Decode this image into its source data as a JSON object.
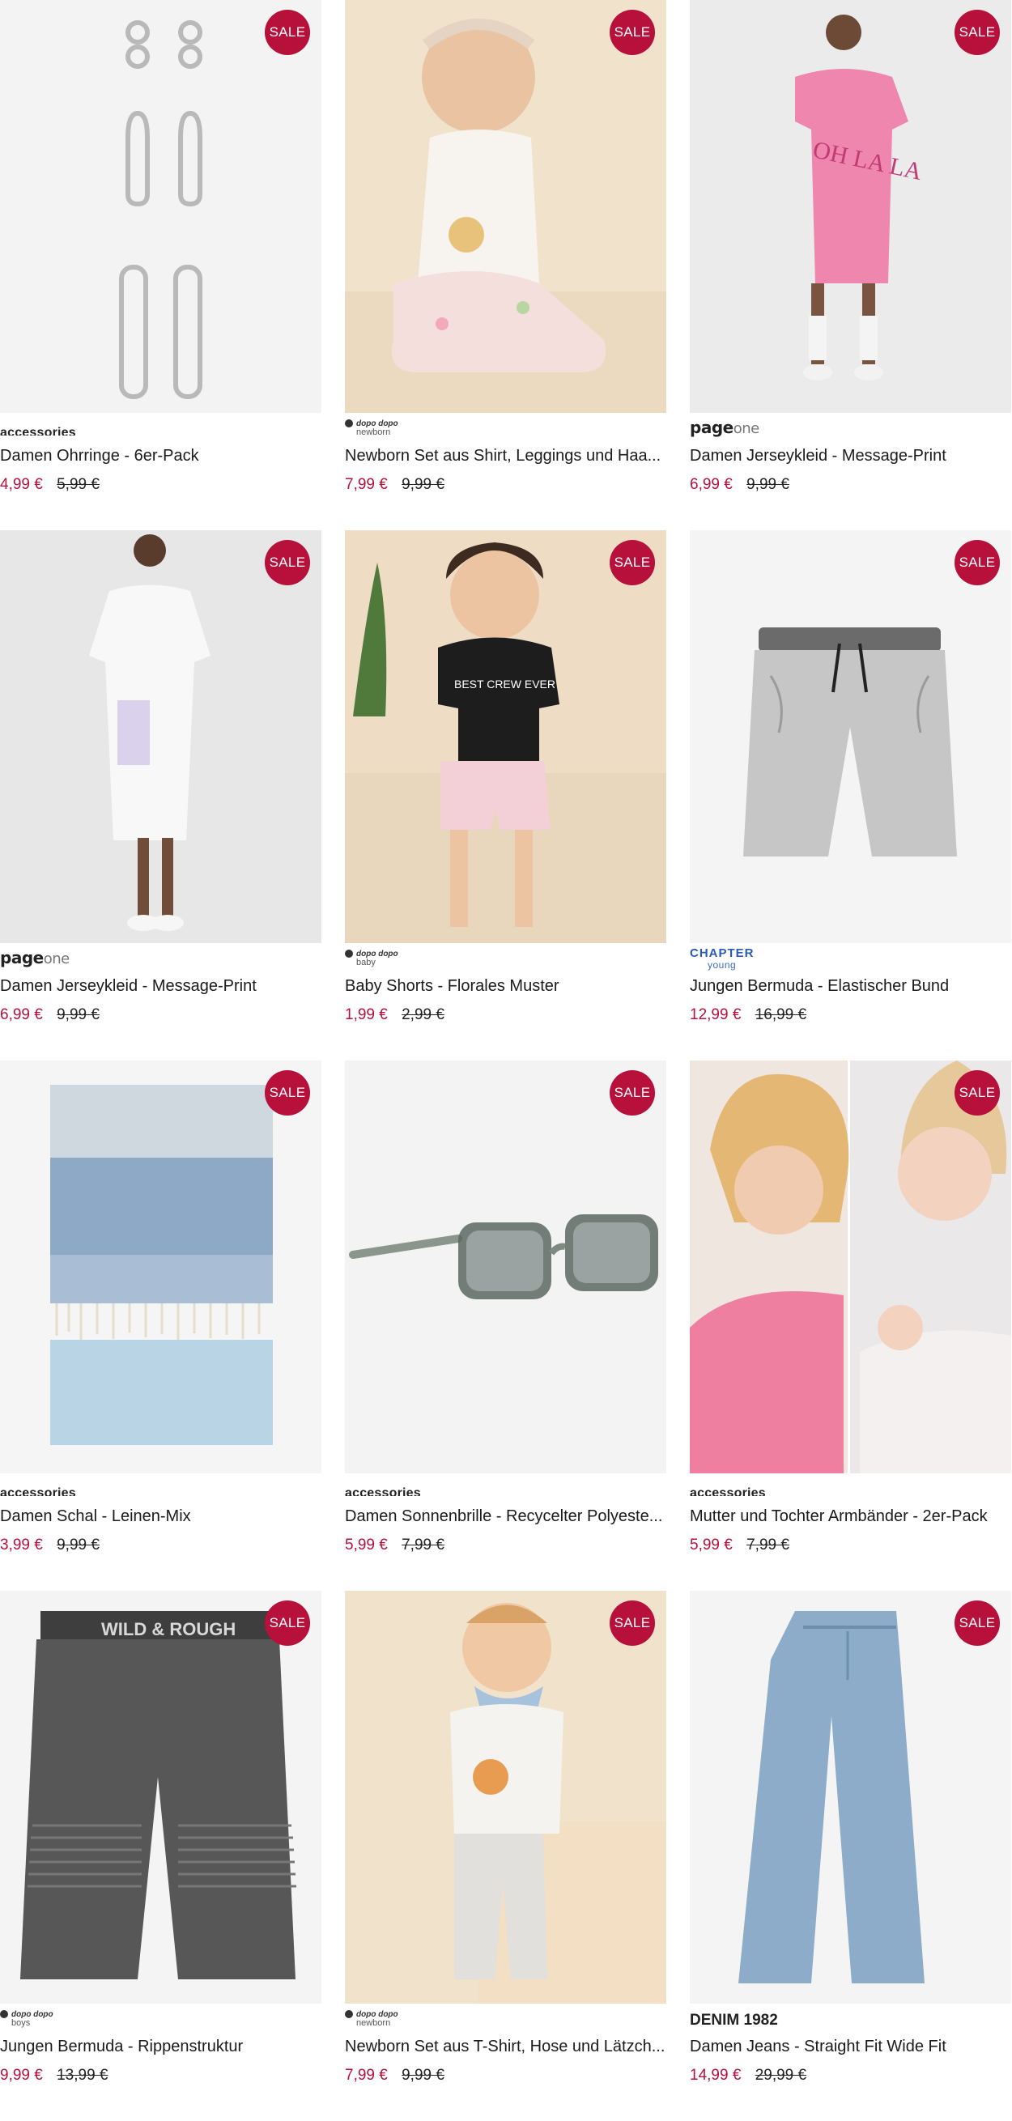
{
  "sale_label": "SALE",
  "products": [
    {
      "brand": "accessories",
      "title": "Damen Ohrringe - 6er-Pack",
      "price": "4,99 €",
      "old_price": "5,99 €"
    },
    {
      "brand": "dopo dopo",
      "brand_sub": "newborn",
      "title": "Newborn Set aus Shirt, Leggings und Haa...",
      "price": "7,99 €",
      "old_price": "9,99 €"
    },
    {
      "brand": "page",
      "brand_suffix": "one",
      "title": "Damen Jerseykleid - Message-Print",
      "price": "6,99 €",
      "old_price": "9,99 €"
    },
    {
      "brand": "page",
      "brand_suffix": "one",
      "title": "Damen Jerseykleid - Message-Print",
      "price": "6,99 €",
      "old_price": "9,99 €"
    },
    {
      "brand": "dopo dopo",
      "brand_sub": "baby",
      "title": "Baby Shorts - Florales Muster",
      "price": "1,99 €",
      "old_price": "2,99 €"
    },
    {
      "brand": "CHAPTER",
      "brand_sub": "young",
      "title": "Jungen Bermuda - Elastischer Bund",
      "price": "12,99 €",
      "old_price": "16,99 €"
    },
    {
      "brand": "accessories",
      "title": "Damen Schal - Leinen-Mix",
      "price": "3,99 €",
      "old_price": "9,99 €"
    },
    {
      "brand": "accessories",
      "title": "Damen Sonnenbrille - Recycelter Polyeste...",
      "price": "5,99 €",
      "old_price": "7,99 €"
    },
    {
      "brand": "accessories",
      "title": "Mutter und Tochter Armbänder - 2er-Pack",
      "price": "5,99 €",
      "old_price": "7,99 €"
    },
    {
      "brand": "dopo dopo",
      "brand_sub": "boys",
      "title": "Jungen Bermuda - Rippenstruktur",
      "price": "9,99 €",
      "old_price": "13,99 €"
    },
    {
      "brand": "dopo dopo",
      "brand_sub": "newborn",
      "title": "Newborn Set aus T-Shirt, Hose und Lätzch...",
      "price": "7,99 €",
      "old_price": "9,99 €"
    },
    {
      "brand": "DENIM 1982",
      "title": "Damen Jeans - Straight Fit Wide Fit",
      "price": "14,99 €",
      "old_price": "29,99 €"
    }
  ],
  "image_text": {
    "dress_print": "OH LA LA",
    "shirt_print": "BEST CREW EVER",
    "jeans_label": "WILD & ROUGH"
  },
  "colors": {
    "sale_badge": "#b6103b",
    "price": "#b6103b",
    "chapter_brand": "#2a5bb0"
  }
}
